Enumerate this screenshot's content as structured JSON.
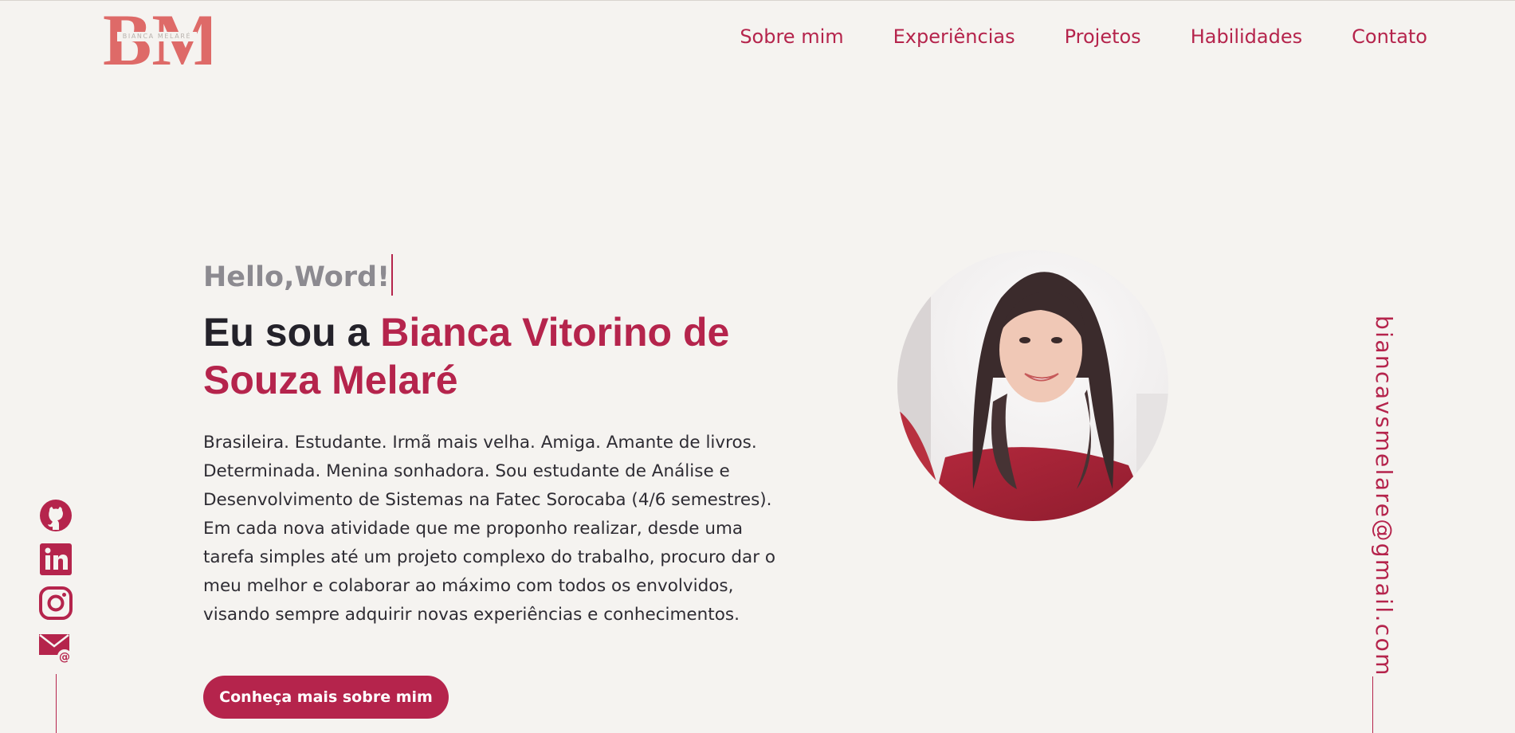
{
  "header": {
    "logo": {
      "initials": "BM",
      "subtitle": "BIANCA MELARÉ"
    },
    "nav": [
      {
        "label": "Sobre mim"
      },
      {
        "label": "Experiências"
      },
      {
        "label": "Projetos"
      },
      {
        "label": "Habilidades"
      },
      {
        "label": "Contato"
      }
    ]
  },
  "hero": {
    "greeting": "Hello,Word!",
    "intro": "Eu sou a ",
    "name": "Bianca Vitorino de Souza Melaré",
    "bio": "Brasileira. Estudante. Irmã mais velha. Amiga. Amante de livros. Determinada. Menina sonhadora. Sou estudante de Análise e Desenvolvimento de Sistemas na Fatec Sorocaba (4/6 semestres). Em cada nova atividade que me proponho realizar, desde uma tarefa simples até um projeto complexo do trabalho, procuro dar o meu melhor e colaborar ao máximo com todos os envolvidos, visando sempre adquirir novas experiências e conhecimentos.",
    "cta_label": "Conheça mais sobre mim"
  },
  "social": [
    {
      "icon": "github-icon"
    },
    {
      "icon": "linkedin-icon"
    },
    {
      "icon": "instagram-icon"
    },
    {
      "icon": "email-icon"
    }
  ],
  "contact": {
    "email": "biancavsmelare@gmail.com"
  },
  "colors": {
    "accent": "#b5244c",
    "background": "#f5f3f0",
    "heading": "#24222a",
    "greeting": "#8c8a90",
    "logo_pink": "#e2726f"
  }
}
